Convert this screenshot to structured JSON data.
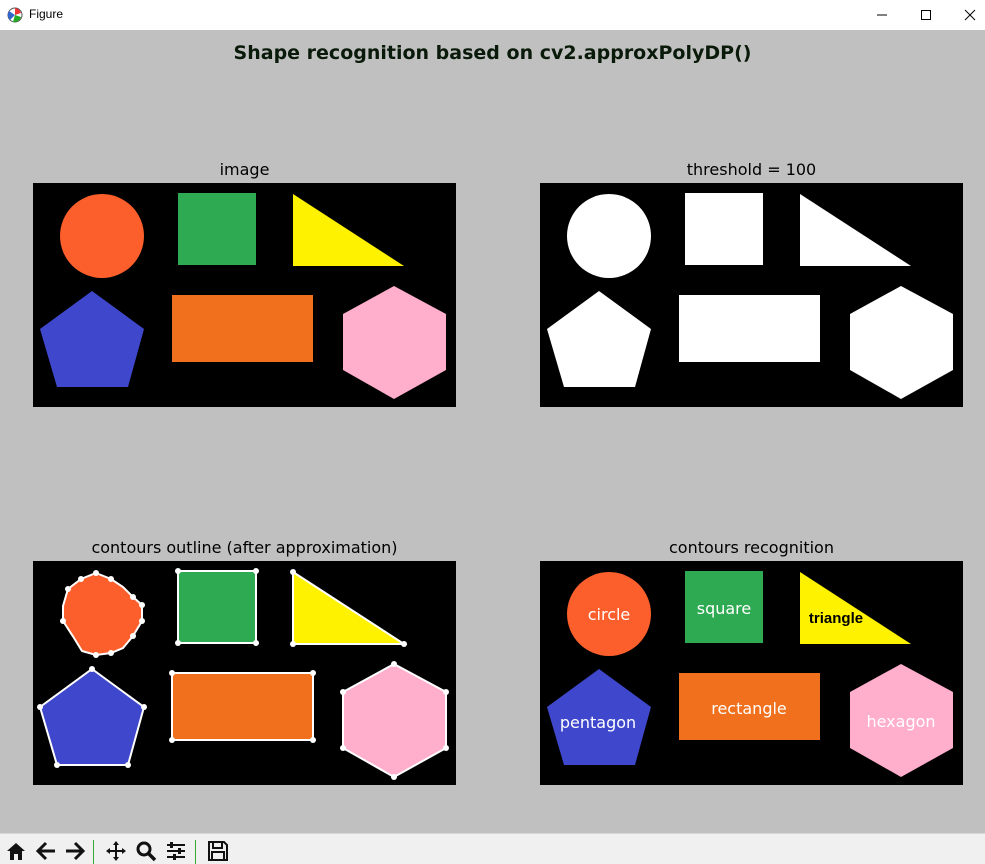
{
  "window": {
    "title": "Figure",
    "app_icon": "matplotlib-icon"
  },
  "window_controls": [
    "minimize-icon",
    "maximize-icon",
    "close-icon"
  ],
  "figure": {
    "suptitle": "Shape recognition based on cv2.approxPolyDP()",
    "panels": [
      {
        "title": "image"
      },
      {
        "title": "threshold = 100"
      },
      {
        "title": "contours outline (after approximation)"
      },
      {
        "title": "contours recognition"
      }
    ],
    "labels": {
      "circle": "circle",
      "square": "square",
      "triangle": "triangle",
      "pentagon": "pentagon",
      "rectangle": "rectangle",
      "hexagon": "hexagon"
    },
    "colors": {
      "background": "#c0c0c0",
      "axes_bg": "#000000",
      "circle": "#fc5f2b",
      "square": "#2eab52",
      "triangle": "#fff200",
      "pentagon": "#3f48cc",
      "rectangle": "#f0701e",
      "hexagon": "#ffaecb",
      "threshold": "#ffffff"
    }
  },
  "toolbar": {
    "buttons": [
      "home-icon",
      "back-icon",
      "forward-icon",
      "pan-icon",
      "zoom-icon",
      "configure-subplots-icon",
      "save-icon"
    ]
  }
}
